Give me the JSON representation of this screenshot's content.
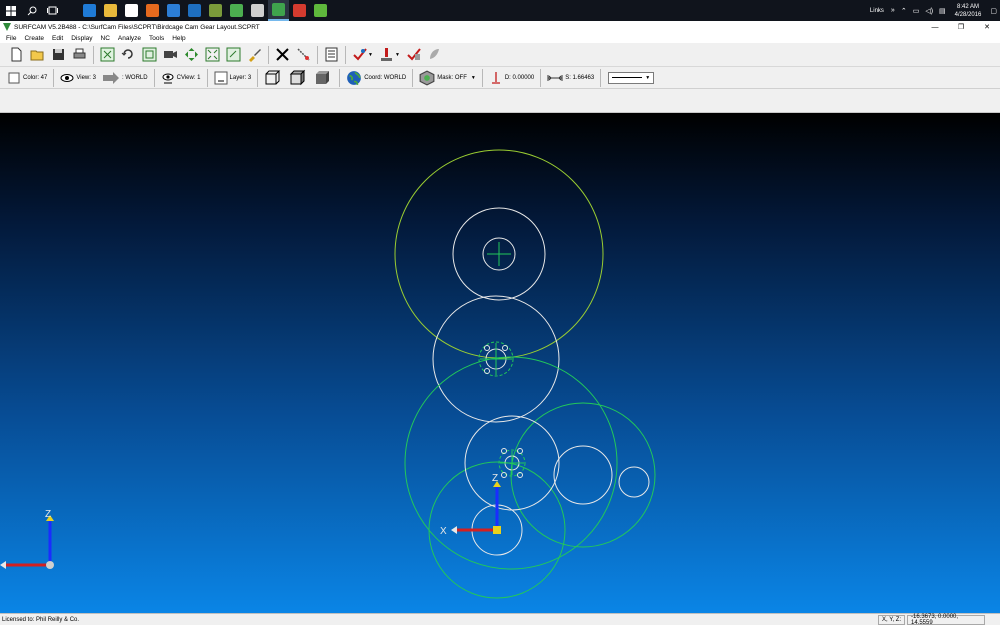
{
  "taskbar": {
    "apps": [
      {
        "name": "edge-app",
        "color": "#1f7bd6"
      },
      {
        "name": "file-explorer-app",
        "color": "#e8b93b"
      },
      {
        "name": "store-app",
        "color": "#ffffff"
      },
      {
        "name": "firefox-app",
        "color": "#e66a1e"
      },
      {
        "name": "mail-app",
        "color": "#2c7ed6"
      },
      {
        "name": "outlook-app",
        "color": "#1e6fc0"
      },
      {
        "name": "app-7",
        "color": "#7a9a3a"
      },
      {
        "name": "app-8",
        "color": "#4caf50"
      },
      {
        "name": "app-9",
        "color": "#cfcfcf"
      },
      {
        "name": "surfcam-app",
        "color": "#3fa34d"
      },
      {
        "name": "app-11",
        "color": "#d43b2f"
      },
      {
        "name": "ie-app",
        "color": "#5fb83c"
      }
    ],
    "tray_label": "Links",
    "time": "8:42 AM",
    "date": "4/28/2016"
  },
  "window": {
    "title": "SURFCAM V5.2B488 - C:\\SurfCam Files\\SCPRT\\Birdcage Cam Gear Layout.SCPRT"
  },
  "menu": [
    "File",
    "Create",
    "Edit",
    "Display",
    "NC",
    "Analyze",
    "Tools",
    "Help"
  ],
  "status_toolbar": {
    "color": "Color: 47",
    "view": "View: 3",
    "view_world": ": WORLD",
    "cview": "CView: 1",
    "layer": "Layer: 3",
    "coord": "Coord: WORLD",
    "mask": "Mask: OFF",
    "depth": "D: 0.00000",
    "step": "S: 1.66463"
  },
  "viewport": {
    "axis_x_label": "X",
    "axis_z_label": "Z",
    "circle_white": "#e8e8e8",
    "circle_green": "#22c85a",
    "circle_yellowgreen": "#9acd32"
  },
  "statusbar": {
    "license": "Licensed to: Phil Reilly & Co.",
    "xyz_label": "X, Y, Z:",
    "xyz_value": "-16.3673, 0.0000, 14.5559"
  }
}
